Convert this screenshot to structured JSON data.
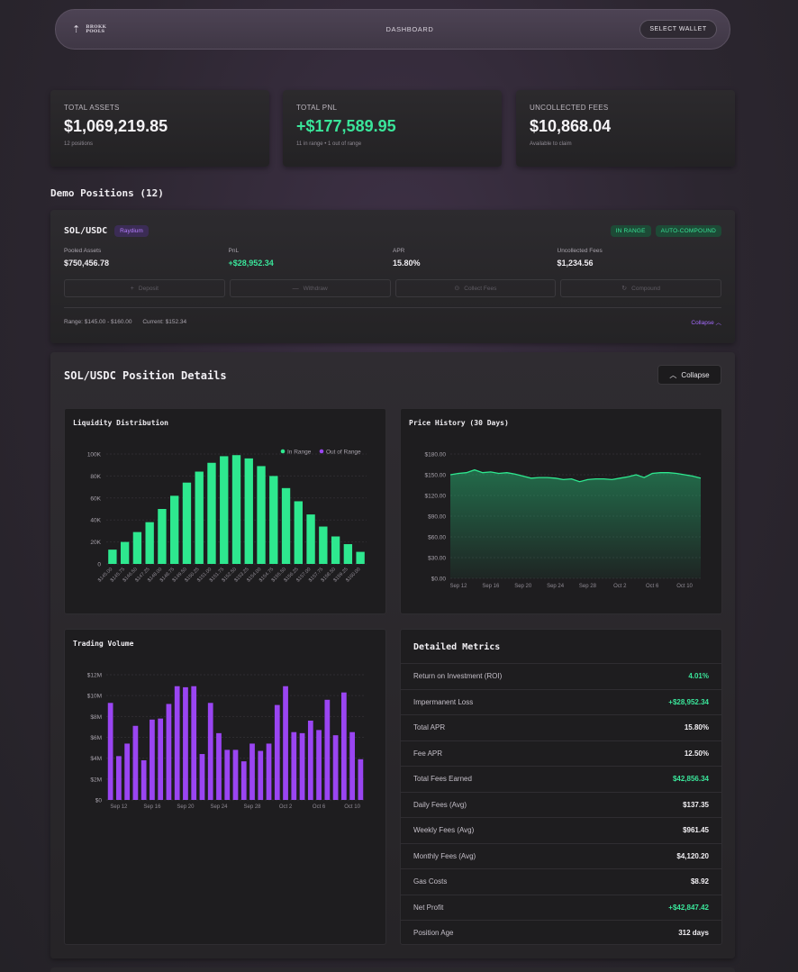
{
  "nav": {
    "logo_line1": "BROKK",
    "logo_line2": "POOLS",
    "dashboard": "DASHBOARD",
    "select_wallet": "SELECT WALLET"
  },
  "stats": [
    {
      "label": "TOTAL ASSETS",
      "value": "$1,069,219.85",
      "sub": "12 positions",
      "green": false
    },
    {
      "label": "TOTAL PNL",
      "value": "+$177,589.95",
      "sub": "11 in range • 1 out of range",
      "green": true
    },
    {
      "label": "UNCOLLECTED FEES",
      "value": "$10,868.04",
      "sub": "Available to claim",
      "green": false
    }
  ],
  "section_title": "Demo Positions (12)",
  "position": {
    "pair": "SOL/USDC",
    "dex": "Raydium",
    "badge_range": "IN RANGE",
    "badge_compound": "AUTO-COMPOUND",
    "metrics": [
      {
        "label": "Pooled Assets",
        "value": "$750,456.78"
      },
      {
        "label": "PnL",
        "value": "+$28,952.34"
      },
      {
        "label": "APR",
        "value": "15.80%"
      },
      {
        "label": "Uncollected Fees",
        "value": "$1,234.56"
      }
    ],
    "actions": {
      "deposit": "Deposit",
      "withdraw": "Withdraw",
      "collect": "Collect Fees",
      "compound": "Compound"
    },
    "range_text": "Range: $145.00 - $160.00",
    "current_text": "Current: $152.34",
    "collapse": "Collapse"
  },
  "details": {
    "title": "SOL/USDC Position Details",
    "collapse": "Collapse",
    "liquidity_title": "Liquidity Distribution",
    "price_title": "Price History (30 Days)",
    "volume_title": "Trading Volume",
    "metrics_title": "Detailed Metrics",
    "metrics": [
      {
        "label": "Return on Investment (ROI)",
        "value": "4.01%",
        "green": true
      },
      {
        "label": "Impermanent Loss",
        "value": "+$28,952.34",
        "green": true
      },
      {
        "label": "Total APR",
        "value": "15.80%",
        "green": false
      },
      {
        "label": "Fee APR",
        "value": "12.50%",
        "green": false
      },
      {
        "label": "Total Fees Earned",
        "value": "$42,856.34",
        "green": true
      },
      {
        "label": "Daily Fees (Avg)",
        "value": "$137.35",
        "green": false
      },
      {
        "label": "Weekly Fees (Avg)",
        "value": "$961.45",
        "green": false
      },
      {
        "label": "Monthly Fees (Avg)",
        "value": "$4,120.20",
        "green": false
      },
      {
        "label": "Gas Costs",
        "value": "$8.92",
        "green": false
      },
      {
        "label": "Net Profit",
        "value": "+$42,847.42",
        "green": true
      },
      {
        "label": "Position Age",
        "value": "312 days",
        "green": false
      }
    ]
  },
  "colors": {
    "green": "#2ee88f",
    "purple": "#9a45f2",
    "accent_text": "#a66bff"
  },
  "chart_data": [
    {
      "type": "bar",
      "title": "Liquidity Distribution",
      "categories": [
        "$145.00",
        "$145.75",
        "$146.50",
        "$147.25",
        "$148.00",
        "$148.75",
        "$149.50",
        "$150.25",
        "$151.00",
        "$151.75",
        "$152.50",
        "$153.25",
        "$154.00",
        "$154.75",
        "$155.50",
        "$156.25",
        "$157.00",
        "$157.75",
        "$158.50",
        "$159.25",
        "$160.00"
      ],
      "series": [
        {
          "name": "In Range",
          "values": [
            13000,
            20000,
            29000,
            38000,
            50000,
            62000,
            74000,
            84000,
            92000,
            98000,
            99000,
            96000,
            89000,
            80000,
            69000,
            57000,
            45000,
            34000,
            25000,
            18000,
            11000
          ]
        }
      ],
      "legend": [
        "In Range",
        "Out of Range"
      ],
      "yticks": [
        "0",
        "20K",
        "40K",
        "60K",
        "80K",
        "100K"
      ],
      "ylim": [
        0,
        100000
      ],
      "legend_position": "top-right",
      "grid": true
    },
    {
      "type": "area",
      "title": "Price History (30 Days)",
      "x": [
        "Sep 11",
        "Sep 12",
        "Sep 13",
        "Sep 14",
        "Sep 15",
        "Sep 16",
        "Sep 17",
        "Sep 18",
        "Sep 19",
        "Sep 20",
        "Sep 21",
        "Sep 22",
        "Sep 23",
        "Sep 24",
        "Sep 25",
        "Sep 26",
        "Sep 27",
        "Sep 28",
        "Sep 29",
        "Sep 30",
        "Oct 1",
        "Oct 2",
        "Oct 3",
        "Oct 4",
        "Oct 5",
        "Oct 6",
        "Oct 7",
        "Oct 8",
        "Oct 9",
        "Oct 10",
        "Oct 11",
        "Oct 12"
      ],
      "values": [
        150,
        152,
        153,
        157,
        153,
        154,
        152,
        153,
        151,
        148,
        145,
        146,
        146,
        145,
        143,
        144,
        140,
        143,
        144,
        144,
        143,
        145,
        147,
        150,
        146,
        152,
        153,
        153,
        152,
        150,
        148,
        145
      ],
      "xticks": [
        "Sep 12",
        "Sep 16",
        "Sep 20",
        "Sep 24",
        "Sep 28",
        "Oct 2",
        "Oct 6",
        "Oct 10"
      ],
      "yticks": [
        "$0.00",
        "$30.00",
        "$60.00",
        "$90.00",
        "$120.00",
        "$150.00",
        "$180.00"
      ],
      "ylim": [
        0,
        180
      ],
      "grid": true
    },
    {
      "type": "bar",
      "title": "Trading Volume",
      "x": [
        "Sep 11",
        "Sep 12",
        "Sep 13",
        "Sep 14",
        "Sep 15",
        "Sep 16",
        "Sep 17",
        "Sep 18",
        "Sep 19",
        "Sep 20",
        "Sep 21",
        "Sep 22",
        "Sep 23",
        "Sep 24",
        "Sep 25",
        "Sep 26",
        "Sep 27",
        "Sep 28",
        "Sep 29",
        "Sep 30",
        "Oct 1",
        "Oct 2",
        "Oct 3",
        "Oct 4",
        "Oct 5",
        "Oct 6",
        "Oct 7",
        "Oct 8",
        "Oct 9",
        "Oct 10",
        "Oct 11",
        "Oct 12"
      ],
      "values": [
        9.3,
        4.2,
        5.4,
        7.1,
        3.8,
        7.7,
        7.8,
        9.2,
        10.9,
        10.8,
        10.9,
        4.4,
        9.3,
        6.4,
        4.8,
        4.8,
        3.7,
        5.4,
        4.7,
        5.4,
        9.1,
        10.9,
        6.5,
        6.4,
        7.6,
        6.7,
        9.6,
        6.2,
        10.3,
        6.5,
        3.9
      ],
      "xticks": [
        "Sep 12",
        "Sep 16",
        "Sep 20",
        "Sep 24",
        "Sep 28",
        "Oct 2",
        "Oct 6",
        "Oct 10"
      ],
      "yticks": [
        "$0",
        "$2M",
        "$4M",
        "$6M",
        "$8M",
        "$10M",
        "$12M"
      ],
      "ylim": [
        0,
        12
      ],
      "unit": "$M",
      "grid": true
    }
  ]
}
